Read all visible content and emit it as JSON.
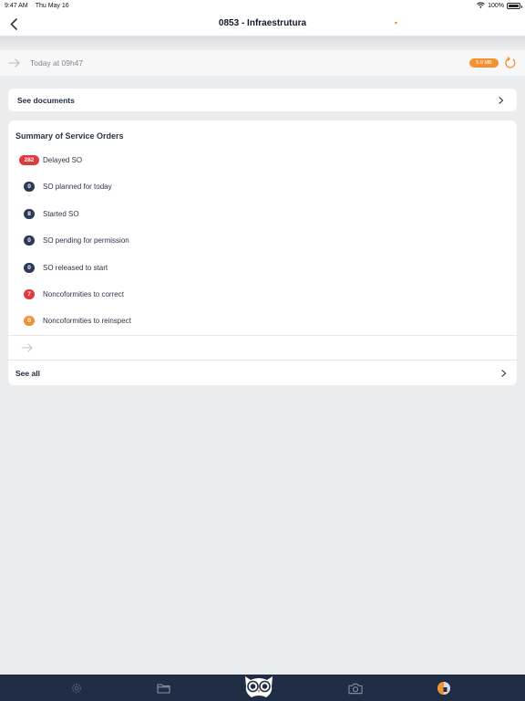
{
  "status_bar": {
    "time": "9:47 AM",
    "date": "Thu May 16",
    "battery": "100%"
  },
  "nav": {
    "title": "0853 - Infraestrutura",
    "back_icon": "chevron-left-icon",
    "caret": "▾"
  },
  "sync": {
    "text": "Today at 09h47",
    "size": "5.9 MB"
  },
  "documents": {
    "label": "See documents"
  },
  "summary": {
    "title": "Summary of Service Orders",
    "items": [
      {
        "count": "282",
        "label": "Delayed SO",
        "color": "#e03a3e"
      },
      {
        "count": "0",
        "label": "SO planned for today",
        "color": "#2d3a55"
      },
      {
        "count": "8",
        "label": "Started SO",
        "color": "#2d3a55"
      },
      {
        "count": "0",
        "label": "SO pending for permission",
        "color": "#2d3a55"
      },
      {
        "count": "0",
        "label": "SO released to start",
        "color": "#2d3a55"
      },
      {
        "count": "7",
        "label": "Noncoformities to correct",
        "color": "#e03a3e"
      },
      {
        "count": "0",
        "label": "Noncoformities to reinspect",
        "color": "#f29333"
      }
    ],
    "see_all": "See all"
  },
  "tabs": [
    {
      "name": "settings",
      "icon": "gear-icon"
    },
    {
      "name": "documents",
      "icon": "folder-icon"
    },
    {
      "name": "home",
      "icon": "owl-icon"
    },
    {
      "name": "camera",
      "icon": "camera-icon"
    },
    {
      "name": "sync-status",
      "icon": "sync-status-icon"
    }
  ],
  "colors": {
    "accent": "#f29333",
    "navy": "#212c45",
    "danger": "#e03a3e"
  }
}
